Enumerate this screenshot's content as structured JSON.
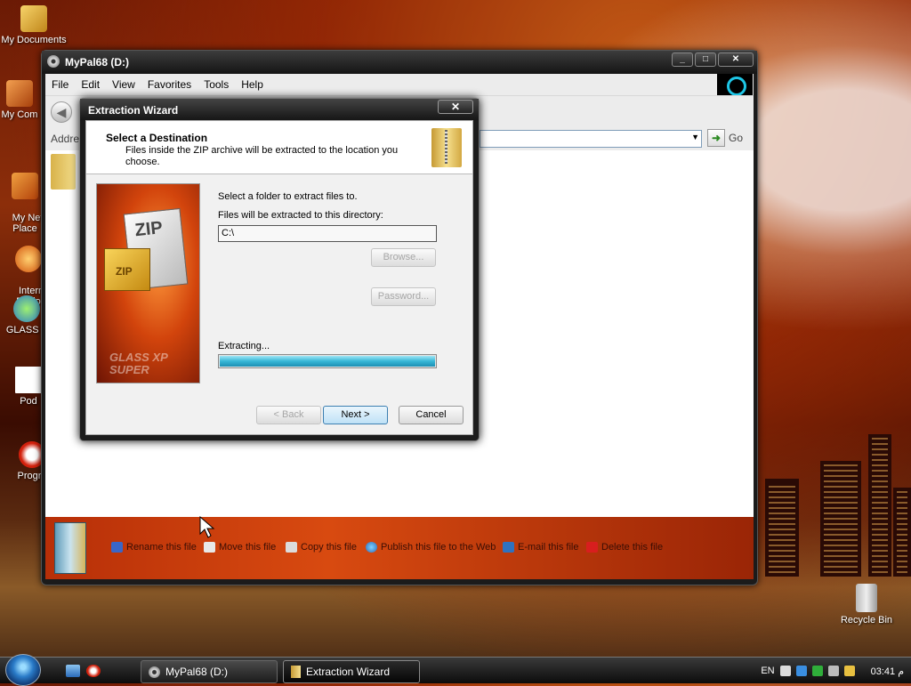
{
  "desktop": {
    "icons": [
      {
        "label": "My Documents"
      },
      {
        "label": "My Com"
      },
      {
        "label": "My Net\nPlace"
      },
      {
        "label": "Intern\nExplo"
      },
      {
        "label": "GLASS T"
      },
      {
        "label": "Pod"
      },
      {
        "label": "Progra"
      },
      {
        "label": "Recycle Bin"
      }
    ]
  },
  "explorer": {
    "title": "MyPal68 (D:)",
    "menu": [
      "File",
      "Edit",
      "View",
      "Favorites",
      "Tools",
      "Help"
    ],
    "address_label": "Addres",
    "go_label": "Go",
    "tasks": [
      "Rename this file",
      "Move this file",
      "Copy this file",
      "Publish this file to the Web",
      "E-mail this file",
      "Delete this file"
    ]
  },
  "dialog": {
    "title": "Extraction Wizard",
    "heading": "Select a Destination",
    "description": "Files inside the ZIP archive will be extracted to the location you choose.",
    "banner_card_text": "ZIP",
    "banner_box_text": "ZIP",
    "banner_logo": "GLASS XP\nSUPER",
    "select_label": "Select a folder to extract files to.",
    "dir_label": "Files will be extracted to this directory:",
    "path_value": "C:\\",
    "browse_label": "Browse...",
    "password_label": "Password...",
    "status_label": "Extracting...",
    "progress": 1.0,
    "back_label": "< Back",
    "next_label": "Next >",
    "cancel_label": "Cancel"
  },
  "taskbar": {
    "buttons": [
      {
        "label": "MyPal68 (D:)"
      },
      {
        "label": "Extraction Wizard"
      }
    ],
    "tray": {
      "lang": "EN",
      "clock": "03:41 م"
    }
  },
  "colors": {
    "progress": "#36b6d6",
    "task_text": "#3a0e04",
    "accent": "#1ec6e6"
  }
}
